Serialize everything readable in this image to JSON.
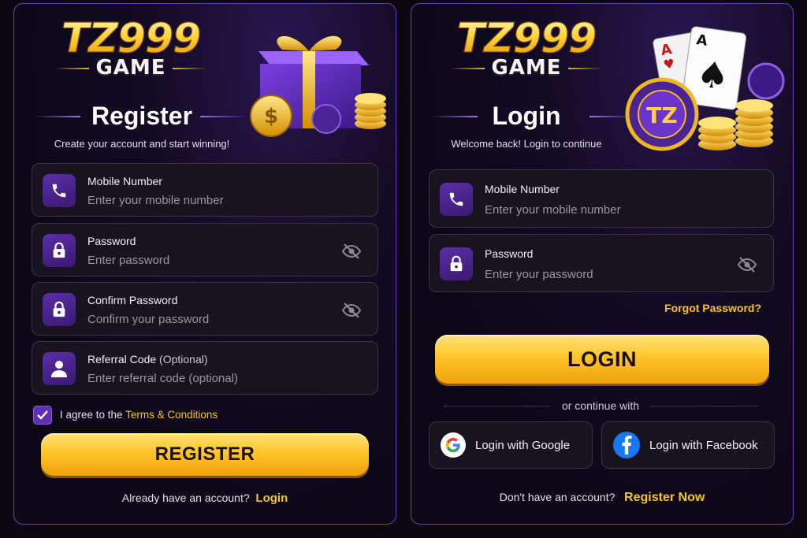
{
  "register": {
    "logo_main": "TZ999",
    "logo_sub": "GAME",
    "title": "Register",
    "subtitle": "Create your account and start winning!",
    "fields": [
      {
        "label": "Mobile Number",
        "placeholder": "Enter your mobile number",
        "icon": "phone-icon"
      },
      {
        "label": "Password",
        "placeholder": "Enter password",
        "icon": "lock-icon"
      },
      {
        "label": "Confirm Password",
        "placeholder": "Confirm your password",
        "icon": "lock-icon"
      },
      {
        "label": "Referral Code",
        "label_suffix": "(Optional)",
        "placeholder": "Enter referral code (optional)",
        "icon": "user-icon"
      }
    ],
    "terms_prefix": "I agree to the",
    "terms_link": "Terms & Conditions",
    "terms_checked": true,
    "submit": "REGISTER",
    "footer_text": "Already have an account?",
    "footer_link": "Login"
  },
  "login": {
    "logo_main": "TZ999",
    "logo_sub": "GAME",
    "chip_text": "TZ",
    "title": "Login",
    "subtitle": "Welcome back! Login to continue",
    "fields": [
      {
        "label": "Mobile Number",
        "placeholder": "Enter your mobile number",
        "icon": "phone-icon"
      },
      {
        "label": "Password",
        "placeholder": "Enter your password",
        "icon": "lock-icon"
      }
    ],
    "forgot": "Forgot Password?",
    "submit": "LOGIN",
    "divider": "or continue with",
    "google": "Login with Google",
    "facebook": "Login with Facebook",
    "footer_text": "Don't have an account?",
    "footer_link": "Register Now"
  },
  "colors": {
    "accent_gold": "#f7c520",
    "accent_purple": "#5e2fb0",
    "panel_border": "#6a3fb5",
    "background": "#0b0713"
  }
}
